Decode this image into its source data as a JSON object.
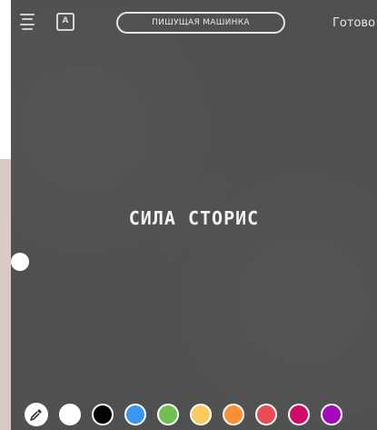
{
  "toolbar": {
    "font_name": "ПИШУЩАЯ МАШИНКА",
    "done_label": "Готово",
    "style_label": "A"
  },
  "canvas": {
    "text": "СИЛА СТОРИС"
  },
  "palette": {
    "colors": [
      "#ffffff",
      "#000000",
      "#3897f0",
      "#70c050",
      "#fdcb5c",
      "#fd8d32",
      "#ed4956",
      "#d10869",
      "#a307ba"
    ]
  }
}
